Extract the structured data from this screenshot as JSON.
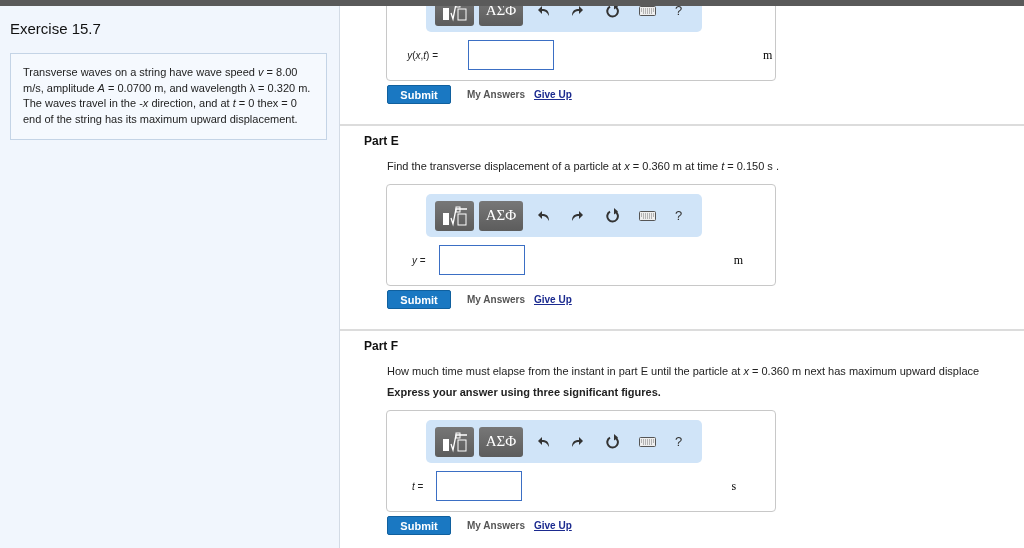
{
  "exercise_title": "Exercise 15.7",
  "problem_text": "Transverse waves on a string have wave speed *v* = 8.00 m/s, amplitude *A* = 0.0700 m, and wavelength λ = 0.320 m. The waves travel in the -*x* direction, and at *t* = 0 thex = 0 end of the string has its maximum upward displacement.",
  "parts": [
    {
      "toolbar": [
        {
          "kind": "template"
        },
        {
          "kind": "symbols",
          "label": "ΑΣΦ"
        },
        {
          "kind": "undo"
        },
        {
          "kind": "redo"
        },
        {
          "kind": "reset"
        },
        {
          "kind": "keyboard"
        },
        {
          "kind": "help",
          "label": "?"
        }
      ],
      "answer_label": "*y*(*x*,*t*) =",
      "unit": "m",
      "submit": "Submit",
      "my_answers": "My Answers",
      "give_up": "Give Up"
    },
    {
      "title": "Part E",
      "question": "Find the transverse displacement of a particle at *x* = 0.360 m at time *t* = 0.150 s .",
      "toolbar": [
        {
          "kind": "template"
        },
        {
          "kind": "symbols",
          "label": "ΑΣΦ"
        },
        {
          "kind": "undo"
        },
        {
          "kind": "redo"
        },
        {
          "kind": "reset"
        },
        {
          "kind": "keyboard"
        },
        {
          "kind": "help",
          "label": "?"
        }
      ],
      "answer_label": "*y* =",
      "unit": "m",
      "submit": "Submit",
      "my_answers": "My Answers",
      "give_up": "Give Up"
    },
    {
      "title": "Part F",
      "question": "How much time must elapse from the instant in part E until the particle at *x* = 0.360 m next has maximum upward displace",
      "instruction": "Express your answer using three significant figures.",
      "toolbar": [
        {
          "kind": "template"
        },
        {
          "kind": "symbols",
          "label": "ΑΣΦ"
        },
        {
          "kind": "undo"
        },
        {
          "kind": "redo"
        },
        {
          "kind": "reset"
        },
        {
          "kind": "keyboard"
        },
        {
          "kind": "help",
          "label": "?"
        }
      ],
      "answer_label": "*t* =",
      "unit": "s",
      "submit": "Submit",
      "my_answers": "My Answers",
      "give_up": "Give Up"
    }
  ]
}
